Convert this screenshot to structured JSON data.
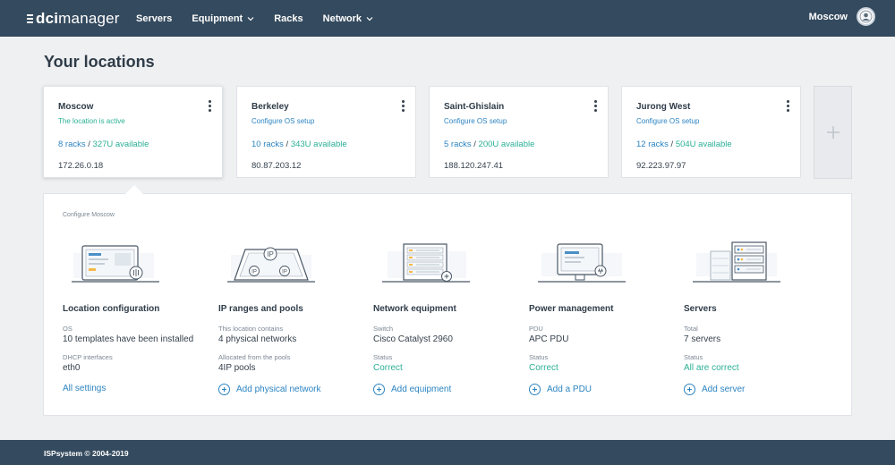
{
  "header": {
    "logo_brand": "dci",
    "logo_product": "manager",
    "nav": [
      {
        "label": "Servers",
        "has_dropdown": false
      },
      {
        "label": "Equipment",
        "has_dropdown": true
      },
      {
        "label": "Racks",
        "has_dropdown": false
      },
      {
        "label": "Network",
        "has_dropdown": true
      }
    ],
    "user_location": "Moscow"
  },
  "page_title": "Your locations",
  "locations": [
    {
      "name": "Moscow",
      "status": "The location is active",
      "racks": "8 racks",
      "available": "327U available",
      "ip": "172.26.0.18"
    },
    {
      "name": "Berkeley",
      "status": "Configure OS setup",
      "racks": "10 racks",
      "available": "343U available",
      "ip": "80.87.203.12"
    },
    {
      "name": "Saint-Ghislain",
      "status": "Configure OS setup",
      "racks": "5 racks",
      "available": "200U available",
      "ip": "188.120.247.41"
    },
    {
      "name": "Jurong West",
      "status": "Configure OS setup",
      "racks": "12 racks",
      "available": "504U available",
      "ip": "92.223.97.97"
    }
  ],
  "rack_separator": "/",
  "configure": {
    "caption": "Configure Moscow",
    "sections": [
      {
        "title": "Location configuration",
        "field1_label": "OS",
        "field1_value": "10 templates have been installed",
        "field2_label": "DHCP interfaces",
        "field2_value": "eth0",
        "action": "All settings"
      },
      {
        "title": "IP ranges and pools",
        "field1_label": "This location contains",
        "field1_value": "4 physical networks",
        "field2_label": "Allocated from the pools",
        "field2_value": "4IP pools",
        "action": "Add physical network"
      },
      {
        "title": "Network equipment",
        "field1_label": "Switch",
        "field1_value": "Cisco Catalyst 2960",
        "field2_label": "Status",
        "field2_value": "Correct",
        "action": "Add equipment"
      },
      {
        "title": "Power management",
        "field1_label": "PDU",
        "field1_value": "APC PDU",
        "field2_label": "Status",
        "field2_value": "Correct",
        "action": "Add a PDU"
      },
      {
        "title": "Servers",
        "field1_label": "Total",
        "field1_value": "7 servers",
        "field2_label": "Status",
        "field2_value": "All are correct",
        "action": "Add server"
      }
    ]
  },
  "illustration_text": {
    "ip_big": "IP",
    "ip_small": "IP"
  },
  "footer": {
    "copyright": "ISPsystem © 2004-2019"
  },
  "colors": {
    "header_bg": "#344a5e",
    "link_blue": "#2c84c1",
    "ok_green": "#2bb095",
    "page_bg": "#eef0f2"
  }
}
